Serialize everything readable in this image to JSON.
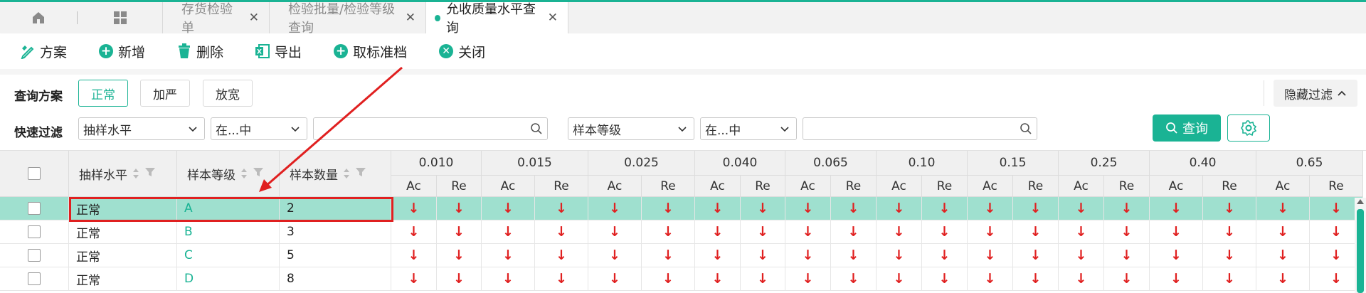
{
  "tabs": [
    {
      "label": "存货检验单"
    },
    {
      "label": "检验批量/检验等级查询"
    },
    {
      "label": "允收质量水平查询"
    }
  ],
  "toolbar": {
    "scheme": "方案",
    "add": "新增",
    "delete": "删除",
    "export": "导出",
    "cancel_standard": "取标准档",
    "close": "关闭"
  },
  "filter": {
    "scheme_label": "查询方案",
    "schemes": [
      "正常",
      "加严",
      "放宽"
    ],
    "hide_filter": "隐藏过滤",
    "quick_label": "快速过滤",
    "field1": "抽样水平",
    "op1": "在...中",
    "field2": "样本等级",
    "op2": "在...中",
    "query": "查询"
  },
  "table": {
    "col_level": "抽样水平",
    "col_grade": "样本等级",
    "col_qty": "样本数量",
    "aql": [
      "0.010",
      "0.015",
      "0.025",
      "0.040",
      "0.065",
      "0.10",
      "0.15",
      "0.25",
      "0.40",
      "0.65"
    ],
    "ac": "Ac",
    "re": "Re",
    "arrow": "↓",
    "rows": [
      {
        "level": "正常",
        "grade": "A",
        "qty": "2"
      },
      {
        "level": "正常",
        "grade": "B",
        "qty": "3"
      },
      {
        "level": "正常",
        "grade": "C",
        "qty": "5"
      },
      {
        "level": "正常",
        "grade": "D",
        "qty": "8"
      }
    ]
  },
  "colors": {
    "accent": "#1ab394",
    "selected_row": "#9fe0cf",
    "annotation": "#e02020"
  }
}
